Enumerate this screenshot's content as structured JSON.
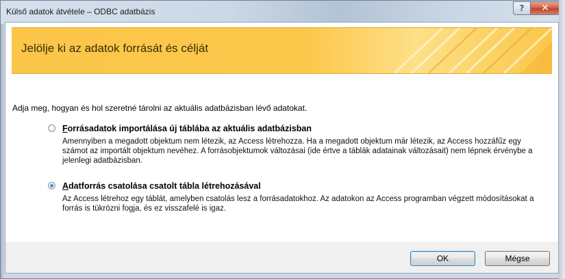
{
  "window": {
    "title": "Külső adatok átvétele – ODBC adatbázis",
    "help_glyph": "?",
    "close_glyph": "✕"
  },
  "banner": {
    "title": "Jelölje ki az adatok forrását és célját",
    "accent_color": "#fbc64a"
  },
  "prompt": "Adja meg, hogyan és hol szeretné tárolni az aktuális adatbázisban lévő adatokat.",
  "options": [
    {
      "accel": "F",
      "label_rest": "orrásadatok importálása új táblába az aktuális adatbázisban",
      "selected": false,
      "description": "Amennyiben a megadott objektum nem létezik, az Access létrehozza. Ha a megadott objektum már létezik, az Access hozzáfűz egy számot az importált objektum nevéhez. A forrásobjektumok változásai (ide értve a táblák adatainak változásait) nem lépnek érvénybe a jelenlegi adatbázisban."
    },
    {
      "accel": "A",
      "label_rest": "datforrás csatolása csatolt tábla létrehozásával",
      "selected": true,
      "description": "Az Access létrehoz egy táblát, amelyben csatolás lesz a forrásadatokhoz. Az adatokon az Access programban végzett módosításokat a forrás is tükrözni fogja, és ez visszafelé is igaz."
    }
  ],
  "buttons": {
    "ok": "OK",
    "cancel": "Mégse"
  }
}
